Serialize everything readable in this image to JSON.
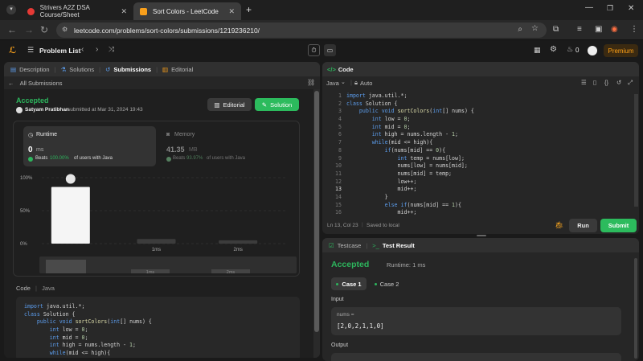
{
  "browser": {
    "tabs": [
      {
        "title": "Strivers A2Z DSA Course/Sheet",
        "favicon_color": "#e53935"
      },
      {
        "title": "Sort Colors - LeetCode",
        "favicon_color": "#f89f1b"
      }
    ],
    "new_tab": "+",
    "url": "leetcode.com/problems/sort-colors/submissions/1219236210/"
  },
  "lc_nav": {
    "problem_list": "Problem List",
    "streak_count": "0",
    "premium": "Premium"
  },
  "left": {
    "tabs": [
      "Description",
      "Solutions",
      "Submissions",
      "Editorial"
    ],
    "back_label": "All Submissions",
    "status": "Accepted",
    "author": "Satyam Pratibhan",
    "submitted_text": "submitted at Mar 31, 2024 19:43",
    "editorial_button": "Editorial",
    "solution_button": "Solution",
    "runtime": {
      "label": "Runtime",
      "value": "0",
      "unit": "ms",
      "beats_prefix": "Beats",
      "beats_pct": "100.00%",
      "beats_suffix": "of users with Java"
    },
    "memory": {
      "label": "Memory",
      "value": "41.35",
      "unit": "MB",
      "beats_prefix": "Beats",
      "beats_pct": "93.97%",
      "beats_suffix": "of users with Java"
    },
    "chart_data": {
      "type": "bar",
      "categories": [
        "",
        "1ms",
        "2ms"
      ],
      "values": [
        86,
        7,
        5
      ],
      "yticks": [
        "100%",
        "50%",
        "0%"
      ],
      "ylim": [
        0,
        100
      ]
    },
    "mini_labels": [
      "1ms",
      "2ms"
    ],
    "code_title": "Code",
    "code_lang": "Java",
    "code_lines": [
      "import java.util.*;",
      "class Solution {",
      "    public void sortColors(int[] nums) {",
      "        int low = 0;",
      "        int mid = 0;",
      "        int high = nums.length - 1;",
      "        while(mid <= high){"
    ]
  },
  "editor": {
    "title": "Code",
    "language": "Java",
    "auto": "Auto",
    "lines": [
      "import java.util.*;",
      "class Solution {",
      "    public void sortColors(int[] nums) {",
      "        int low = 0;",
      "        int mid = 0;",
      "        int high = nums.length - 1;",
      "        while(mid <= high){",
      "            if(nums[mid] == 0){",
      "                int temp = nums[low];",
      "                nums[low] = nums[mid];",
      "                nums[mid] = temp;",
      "                low++;",
      "                mid++;",
      "            }",
      "            else if(nums[mid] == 1){",
      "                mid++;"
    ],
    "line_numbers": [
      "1",
      "2",
      "3",
      "4",
      "5",
      "6",
      "7",
      "8",
      "9",
      "10",
      "11",
      "12",
      "13",
      "14",
      "15",
      "16"
    ],
    "cursor": "Ln 13, Col 23",
    "saved": "Saved to local",
    "run": "Run",
    "submit": "Submit"
  },
  "result": {
    "tabs": [
      "Testcase",
      "Test Result"
    ],
    "status": "Accepted",
    "runtime": "Runtime: 1 ms",
    "cases": [
      "Case 1",
      "Case 2"
    ],
    "input_label": "Input",
    "input_var": "nums =",
    "input_value": "[2,0,2,1,1,0]",
    "output_label": "Output"
  },
  "colors": {
    "accent_green": "#2cbb5d",
    "accepted": "#2db55d",
    "premium": "#ffa116"
  }
}
